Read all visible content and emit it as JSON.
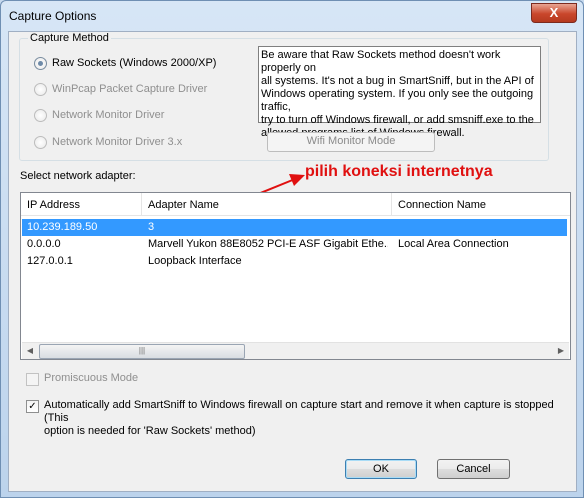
{
  "window": {
    "title": "Capture Options",
    "close_label": "X"
  },
  "capture_method": {
    "legend": "Capture Method",
    "options": [
      {
        "label": "Raw Sockets (Windows 2000/XP)",
        "checked": true,
        "enabled": true
      },
      {
        "label": "WinPcap Packet Capture Driver",
        "checked": false,
        "enabled": false
      },
      {
        "label": "Network Monitor Driver",
        "checked": false,
        "enabled": false
      },
      {
        "label": "Network Monitor Driver 3.x",
        "checked": false,
        "enabled": false
      }
    ],
    "info_lines": [
      "Be aware that Raw Sockets method doesn't work properly on",
      "all systems. It's not a bug in SmartSniff, but in the API of",
      "Windows operating system. If you only see the outgoing traffic,",
      "try to turn off Windows firewall, or add smsniff.exe to the",
      "allowed programs list of Windows firewall."
    ],
    "wifi_button": "Wifi Monitor Mode"
  },
  "adapter": {
    "label": "Select network adapter:",
    "annotation": "pilih koneksi internetnya",
    "columns": [
      "IP Address",
      "Adapter Name",
      "Connection Name"
    ],
    "rows": [
      {
        "ip": "10.239.189.50",
        "adapter": "3",
        "connection": "",
        "selected": true
      },
      {
        "ip": "0.0.0.0",
        "adapter": "Marvell Yukon 88E8052 PCI-E ASF Gigabit Ethe...",
        "connection": "Local Area Connection",
        "selected": false
      },
      {
        "ip": "127.0.0.1",
        "adapter": "Loopback Interface",
        "connection": "",
        "selected": false
      }
    ],
    "scroll_left": "◀",
    "scroll_right": "▶",
    "scroll_grip": "|||"
  },
  "options": {
    "promiscuous": {
      "label": "Promiscuous Mode",
      "checked": false,
      "enabled": false
    },
    "firewall": {
      "line1": "Automatically add SmartSniff to Windows firewall on capture start and remove it when capture is stopped (This",
      "line2": "option is needed for 'Raw Sockets' method)",
      "checked": true,
      "check_glyph": "✓"
    }
  },
  "buttons": {
    "ok": "OK",
    "cancel": "Cancel"
  },
  "colors": {
    "annotation": "#e01010",
    "selection": "#3399ff"
  }
}
